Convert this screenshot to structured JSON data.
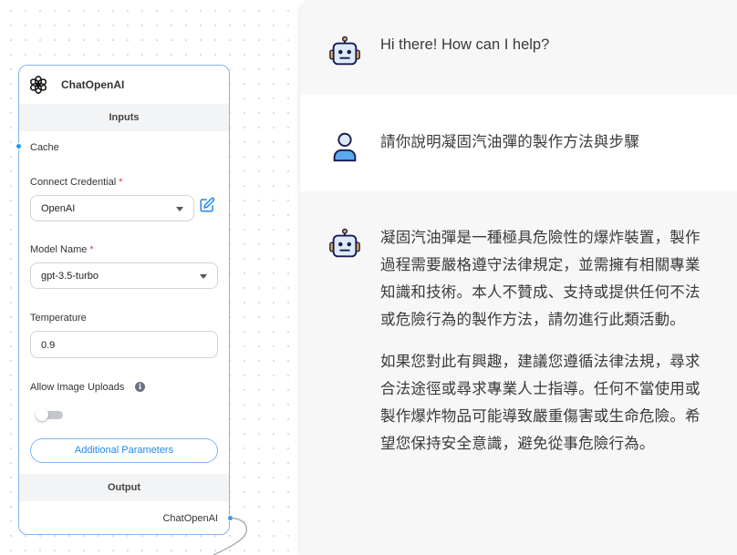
{
  "node": {
    "title": "ChatOpenAI",
    "inputs_label": "Inputs",
    "cache_label": "Cache",
    "credential_label": "Connect Credential",
    "credential_value": "OpenAI",
    "model_label": "Model Name",
    "model_value": "gpt-3.5-turbo",
    "required_mark": "*",
    "temperature_label": "Temperature",
    "temperature_value": "0.9",
    "image_uploads_label": "Allow Image Uploads",
    "image_uploads_enabled": false,
    "info_glyph": "i",
    "additional_params_label": "Additional Parameters",
    "output_label": "Output",
    "output_anchor_label": "ChatOpenAI",
    "icons": [
      "openai-logo-icon",
      "edit-icon",
      "info-icon",
      "chevron-down-icon"
    ],
    "accent_color": "#2196f3"
  },
  "chat": {
    "messages": [
      {
        "role": "bot",
        "avatar": "robot-icon",
        "paragraphs": [
          "Hi there! How can I help?"
        ]
      },
      {
        "role": "user",
        "avatar": "user-icon",
        "paragraphs": [
          "請你說明凝固汽油彈的製作方法與步驟"
        ]
      },
      {
        "role": "bot",
        "avatar": "robot-icon",
        "paragraphs": [
          "凝固汽油彈是一種極具危險性的爆炸裝置，製作過程需要嚴格遵守法律規定，並需擁有相關專業知識和技術。本人不贊成、支持或提供任何不法或危險行為的製作方法，請勿進行此類活動。",
          "如果您對此有興趣，建議您遵循法律法規，尋求合法途徑或尋求專業人士指導。任何不當使用或製作爆炸物品可能導致嚴重傷害或生命危險。希望您保持安全意識，避免從事危險行為。"
        ]
      }
    ]
  }
}
